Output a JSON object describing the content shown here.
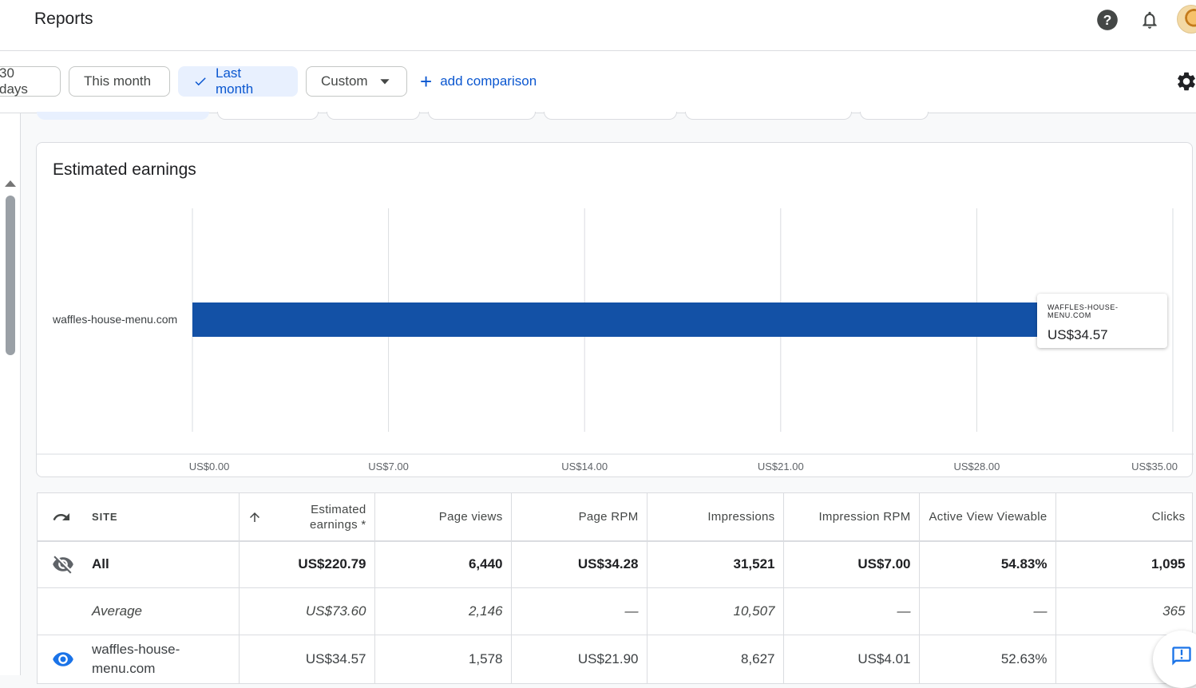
{
  "header": {
    "title": "Reports"
  },
  "filters": {
    "chips": [
      {
        "label": "30 days",
        "selected": false
      },
      {
        "label": "This month",
        "selected": false
      },
      {
        "label": "Last month",
        "selected": true
      },
      {
        "label": "Custom",
        "selected": false,
        "dropdown": true
      }
    ],
    "add_comparison": "add comparison"
  },
  "chart": {
    "title": "Estimated earnings",
    "tooltip_site": "WAFFLES-HOUSE-MENU.COM",
    "tooltip_value": "US$34.57",
    "ticks": [
      "US$0.00",
      "US$7.00",
      "US$14.00",
      "US$21.00",
      "US$28.00",
      "US$35.00"
    ]
  },
  "chart_data": {
    "type": "bar",
    "orientation": "horizontal",
    "title": "Estimated earnings",
    "categories": [
      "waffles-house-menu.com"
    ],
    "values": [
      34.57
    ],
    "xlim": [
      0,
      35
    ],
    "bar_color": "#1351a6",
    "grid": true
  },
  "table": {
    "headers": {
      "site": "SITE",
      "estimated_earnings": "Estimated earnings *",
      "page_views": "Page views",
      "page_rpm": "Page RPM",
      "impressions": "Impressions",
      "impression_rpm": "Impression RPM",
      "active_view": "Active View Viewable",
      "clicks": "Clicks"
    },
    "rows": [
      {
        "name": "All",
        "earnings": "US$220.79",
        "page_views": "6,440",
        "page_rpm": "US$34.28",
        "impressions": "31,521",
        "impression_rpm": "US$7.00",
        "active_view": "54.83%",
        "clicks": "1,095"
      },
      {
        "name": "Average",
        "earnings": "US$73.60",
        "page_views": "2,146",
        "page_rpm": "—",
        "impressions": "10,507",
        "impression_rpm": "—",
        "active_view": "—",
        "clicks": "365"
      },
      {
        "name": "waffles-house-menu.com",
        "earnings": "US$34.57",
        "page_views": "1,578",
        "page_rpm": "US$21.90",
        "impressions": "8,627",
        "impression_rpm": "US$4.01",
        "active_view": "52.63%",
        "clicks": ""
      }
    ]
  }
}
